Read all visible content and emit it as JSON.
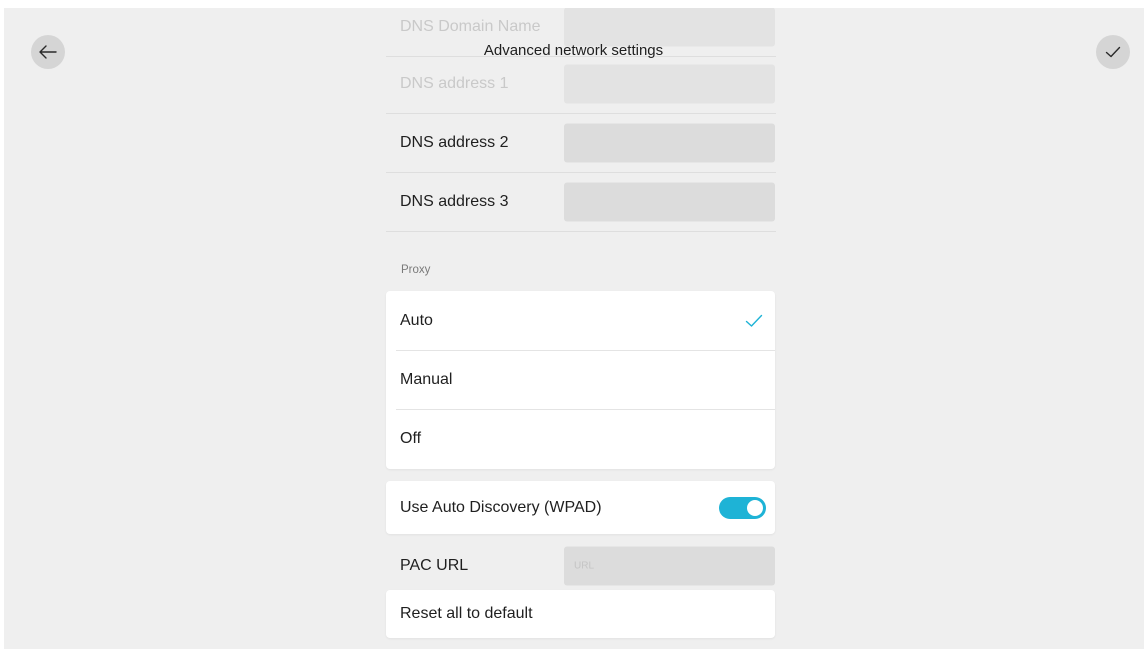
{
  "header": {
    "title": "Advanced network settings",
    "back_icon": "arrow-left-icon",
    "confirm_icon": "checkmark-icon"
  },
  "dns": {
    "domain_name": {
      "label": "DNS Domain Name",
      "value": ""
    },
    "address_1": {
      "label": "DNS address 1",
      "value": ""
    },
    "address_2": {
      "label": "DNS address 2",
      "value": ""
    },
    "address_3": {
      "label": "DNS address 3",
      "value": ""
    }
  },
  "proxy": {
    "section_label": "Proxy",
    "options": [
      {
        "label": "Auto",
        "selected": true
      },
      {
        "label": "Manual",
        "selected": false
      },
      {
        "label": "Off",
        "selected": false
      }
    ],
    "selected_icon": "checkmark-icon"
  },
  "wpad": {
    "label": "Use Auto Discovery (WPAD)",
    "enabled": true
  },
  "pac": {
    "label": "PAC URL",
    "placeholder": "URL",
    "value": ""
  },
  "reset": {
    "label": "Reset all to default"
  },
  "colors": {
    "accent": "#1eb3d6",
    "background": "#efefef",
    "card": "#ffffff",
    "input": "#dcdcdc"
  }
}
